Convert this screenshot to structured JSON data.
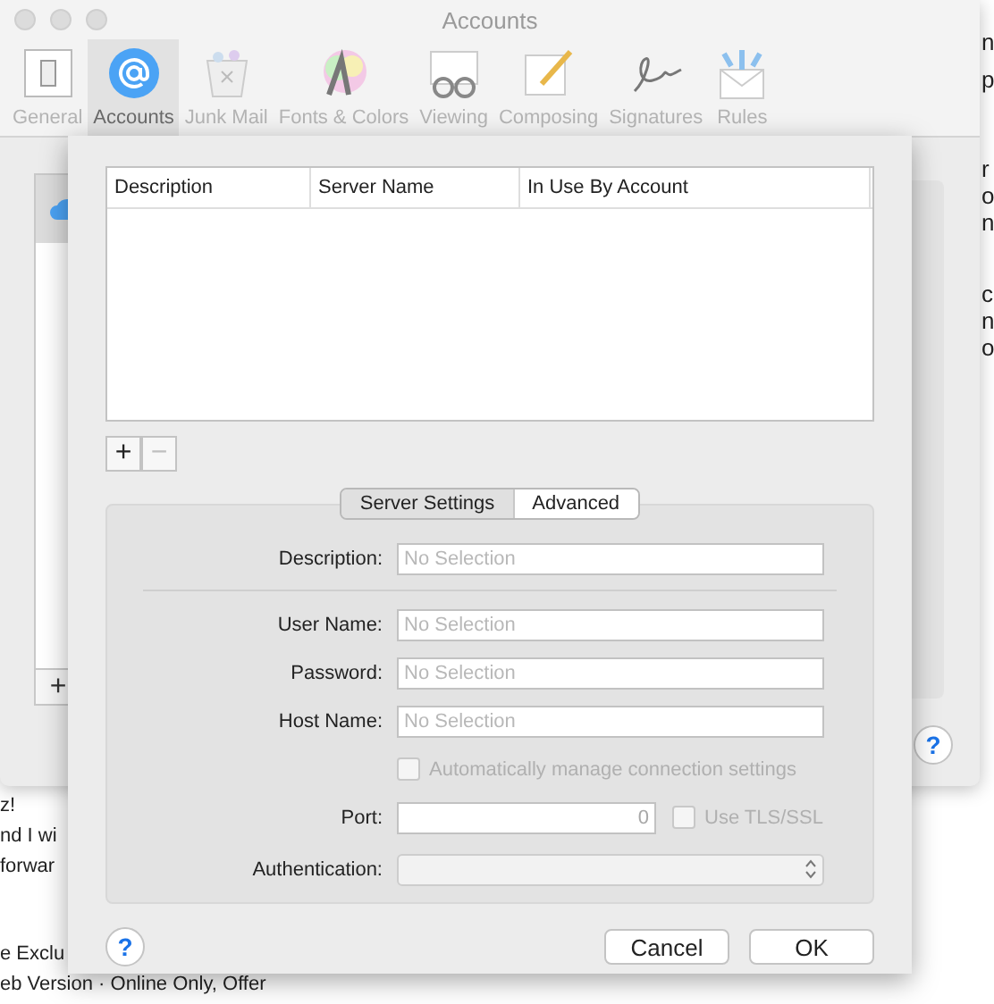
{
  "window": {
    "title": "Accounts"
  },
  "toolbar": [
    {
      "label": "General",
      "kind": "general",
      "selected": false
    },
    {
      "label": "Accounts",
      "kind": "accounts",
      "selected": true
    },
    {
      "label": "Junk Mail",
      "kind": "junk",
      "selected": false
    },
    {
      "label": "Fonts & Colors",
      "kind": "fonts",
      "selected": false
    },
    {
      "label": "Viewing",
      "kind": "viewing",
      "selected": false
    },
    {
      "label": "Composing",
      "kind": "composing",
      "selected": false
    },
    {
      "label": "Signatures",
      "kind": "signatures",
      "selected": false
    },
    {
      "label": "Rules",
      "kind": "rules",
      "selected": false
    }
  ],
  "account_list": {
    "add_button": "+"
  },
  "window_help": "?",
  "sheet": {
    "table": {
      "columns": [
        "Description",
        "Server Name",
        "In Use By Account"
      ]
    },
    "add_button": {
      "label": "+",
      "disabled": false
    },
    "remove_button": {
      "label": "−",
      "disabled": true
    },
    "tabs": [
      {
        "label": "Server Settings",
        "selected": true
      },
      {
        "label": "Advanced",
        "selected": false
      }
    ],
    "rows": [
      {
        "kind": "text",
        "label": "Description:",
        "placeholder": "No Selection"
      },
      {
        "kind": "separator"
      },
      {
        "kind": "text",
        "label": "User Name:",
        "placeholder": "No Selection"
      },
      {
        "kind": "text",
        "label": "Password:",
        "placeholder": "No Selection"
      },
      {
        "kind": "text",
        "label": "Host Name:",
        "placeholder": "No Selection"
      },
      {
        "kind": "checkbox",
        "label": "Automatically manage connection settings",
        "checked": false,
        "disabled": true
      },
      {
        "kind": "port",
        "label": "Port:",
        "value": "0",
        "checkbox": {
          "label": "Use TLS/SSL",
          "checked": false,
          "disabled": true
        }
      },
      {
        "kind": "popup",
        "label": "Authentication:"
      }
    ],
    "help": "?",
    "buttons": [
      "Cancel",
      "OK"
    ]
  },
  "background_text": {
    "right": [
      "n",
      "p",
      "r",
      "o",
      "n",
      "c",
      "n",
      "o"
    ],
    "left": [
      "z!",
      "nd I wi",
      "forwar",
      "e Exclu",
      "eb Version · Online Only, Offer"
    ]
  }
}
